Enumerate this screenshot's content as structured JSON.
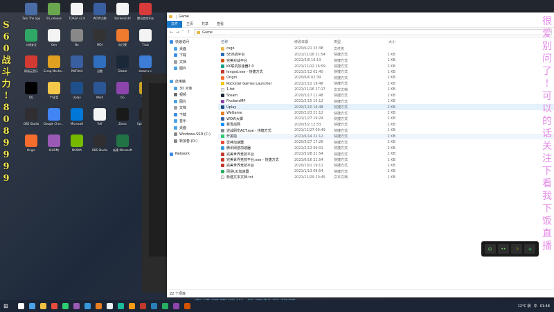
{
  "desktop": {
    "icons": [
      {
        "label": "Task The app",
        "color": "#4a6da7"
      },
      {
        "label": "91_release",
        "color": "#6aa84f"
      },
      {
        "label": "TQAEA v2.9",
        "color": "#f4f4f4"
      },
      {
        "label": "WOW大脚",
        "color": "#3a5fa0"
      },
      {
        "label": "Backend.dll",
        "color": "#f4f4f4"
      },
      {
        "label": "腾讯游戏平台",
        "color": "#d93b3b"
      },
      {
        "label": "火绒安全",
        "color": "#2fa866"
      },
      {
        "label": "Gen",
        "color": "#f4f4f4"
      },
      {
        "label": "Bo",
        "color": "#888888"
      },
      {
        "label": "MOI",
        "color": "#333333"
      },
      {
        "label": "向日葵",
        "color": "#f07b2f"
      },
      {
        "label": "T.bat",
        "color": "#f4f4f4"
      },
      {
        "label": "网易云音乐",
        "color": "#d33a31"
      },
      {
        "label": "Scrap Mechanic",
        "color": "#e0a020"
      },
      {
        "label": "PWFH64",
        "color": "#3a5fa0"
      },
      {
        "label": "迅雷",
        "color": "#2f6fbd"
      },
      {
        "label": "Steam",
        "color": "#1b2838"
      },
      {
        "label": "steam++",
        "color": "#3d7dd8"
      },
      {
        "label": "QQ",
        "color": "#000000"
      },
      {
        "label": "YY语音",
        "color": "#f5c84a"
      },
      {
        "label": "Uplay",
        "color": "#1f4f8a"
      },
      {
        "label": "Word",
        "color": "#2b5797"
      },
      {
        "label": "6G",
        "color": "#8e44ad"
      },
      {
        "label": "WOW",
        "color": "#c9a227"
      },
      {
        "label": "OBS Studio",
        "color": "#302e31"
      },
      {
        "label": "Google Chrome",
        "color": "#4285f4"
      },
      {
        "label": "Microsoft",
        "color": "#0078d7"
      },
      {
        "label": "Toff",
        "color": "#f4f4f4"
      },
      {
        "label": "Zoma",
        "color": "#1a1a1a"
      },
      {
        "label": "Epic Games",
        "color": "#222222"
      },
      {
        "label": "Origin",
        "color": "#f56c2d"
      },
      {
        "label": "4(HDM)",
        "color": "#9b59b6"
      },
      {
        "label": "NVIDIA",
        "color": "#76b900"
      },
      {
        "label": "OBS Studio",
        "color": "#302e31"
      },
      {
        "label": "新建 Microsoft",
        "color": "#217346"
      }
    ],
    "yellow_text": [
      "S",
      "6",
      "0",
      "战",
      "斗",
      "力",
      "!",
      "8",
      "0",
      "8",
      "9",
      "9",
      "9",
      "9"
    ],
    "pink_text": [
      "很",
      "爱",
      "别",
      "问",
      "了",
      "!",
      "可",
      "以",
      "的",
      "话",
      "关",
      "注",
      "下",
      "看",
      "我",
      "下",
      "饭",
      "直",
      "播"
    ]
  },
  "explorer": {
    "title": "Game",
    "ribbon_tabs": [
      "文件",
      "主页",
      "共享",
      "查看"
    ],
    "address": "Game",
    "nav_items": [
      {
        "label": "快速访问",
        "color": "#3c8ce7"
      },
      {
        "label": "桌面",
        "color": "#4aa3e8"
      },
      {
        "label": "下载",
        "color": "#3c8ce7"
      },
      {
        "label": "文档",
        "color": "#9e9e9e"
      },
      {
        "label": "图片",
        "color": "#4aa3e8"
      },
      {
        "label": "",
        "color": "#ffffff"
      },
      {
        "label": "此电脑",
        "color": "#4aa3e8"
      },
      {
        "label": "3D 对象",
        "color": "#4aa3e8"
      },
      {
        "label": "视频",
        "color": "#6d6d6d"
      },
      {
        "label": "图片",
        "color": "#4aa3e8"
      },
      {
        "label": "文档",
        "color": "#9e9e9e"
      },
      {
        "label": "下载",
        "color": "#3c8ce7"
      },
      {
        "label": "音乐",
        "color": "#4aa3e8"
      },
      {
        "label": "桌面",
        "color": "#4aa3e8"
      },
      {
        "label": "Windows-SSD (C:)",
        "color": "#888888"
      },
      {
        "label": "新加卷 (D:)",
        "color": "#888888"
      },
      {
        "label": "",
        "color": "#ffffff"
      },
      {
        "label": "Network",
        "color": "#3c8ce7"
      }
    ],
    "columns": [
      "名称",
      "修改日期",
      "类型",
      "大小"
    ],
    "files": [
      {
        "name": "csgo",
        "date": "2020/6/21 23:38",
        "type": "文件夹",
        "size": "",
        "color": "#e8b84a"
      },
      {
        "name": "5E对战平台",
        "date": "2021/11/18 21:54",
        "type": "快捷方式",
        "size": "2 KB",
        "color": "#2b6cb0"
      },
      {
        "name": "完美对战平台",
        "date": "2021/3/8 16:13",
        "type": "快捷方式",
        "size": "1 KB",
        "color": "#d35400"
      },
      {
        "name": "KK联机加速器2.0",
        "date": "2021/11/12 16:59",
        "type": "快捷方式",
        "size": "2 KB",
        "color": "#16a085"
      },
      {
        "name": "lengod.exe - 快捷方式",
        "date": "2021/2/12 02:40",
        "type": "快捷方式",
        "size": "1 KB",
        "color": "#c0392b"
      },
      {
        "name": "Origin",
        "date": "2020/6/6 02:39",
        "type": "快捷方式",
        "size": "2 KB",
        "color": "#f56c2d"
      },
      {
        "name": "Rockstar Games Launcher",
        "date": "2021/2/12 19:48",
        "type": "快捷方式",
        "size": "2 KB",
        "color": "#f1c40f"
      },
      {
        "name": "1.txt",
        "date": "2021/11/16 17:17",
        "type": "文本文档",
        "size": "1 KB",
        "color": "#ecf0f1"
      },
      {
        "name": "Steam",
        "date": "2020/5/17 11:48",
        "type": "快捷方式",
        "size": "2 KB",
        "color": "#1b2838"
      },
      {
        "name": "FivckersMP",
        "date": "2021/2/15 15:12",
        "type": "快捷方式",
        "size": "1 KB",
        "color": "#8e44ad"
      },
      {
        "name": "Uplay",
        "date": "2020/2/10 16:48",
        "type": "快捷方式",
        "size": "2 KB",
        "color": "#1f4f8a"
      },
      {
        "name": "WeGame",
        "date": "2020/2/23 21:12",
        "type": "快捷方式",
        "size": "2 KB",
        "color": "#e67e22"
      },
      {
        "name": "WOW大脚",
        "date": "2021/1/27 19:24",
        "type": "快捷方式",
        "size": "2 KB",
        "color": "#3a5fa0"
      },
      {
        "name": "暴雪战网",
        "date": "2020/3/2 12:53",
        "type": "快捷方式",
        "size": "2 KB",
        "color": "#148eff"
      },
      {
        "name": "逆战刷伤ACT.exe - 快捷方式",
        "date": "2021/12/27 00:49",
        "type": "快捷方式",
        "size": "1 KB",
        "color": "#7f8c8d"
      },
      {
        "name": "开黑啦",
        "date": "2021/6/14 22:12",
        "type": "快捷方式",
        "size": "2 KB",
        "color": "#2ecc71"
      },
      {
        "name": "雷神加速器",
        "date": "2020/3/27 17:26",
        "type": "快捷方式",
        "size": "2 KB",
        "color": "#e74c3c"
      },
      {
        "name": "腾讯网游加速器",
        "date": "2021/2/12 09:01",
        "type": "快捷方式",
        "size": "2 KB",
        "color": "#3498db"
      },
      {
        "name": "完美世界竞技平台",
        "date": "2021/5/28 21:54",
        "type": "快捷方式",
        "size": "2 KB",
        "color": "#c0392b"
      },
      {
        "name": "完美世界竞技平台.exe - 快捷方式",
        "date": "2021/6/16 21:54",
        "type": "快捷方式",
        "size": "1 KB",
        "color": "#c0392b"
      },
      {
        "name": "完美世界竞技平台",
        "date": "2020/10/1 19:11",
        "type": "快捷方式",
        "size": "2 KB",
        "color": "#c0392b"
      },
      {
        "name": "网易UU加速器",
        "date": "2021/1/13 08:54",
        "type": "快捷方式",
        "size": "2 KB",
        "color": "#27ae60"
      },
      {
        "name": "新建文本文档.txt",
        "date": "2021/11/29 20:45",
        "type": "文本文档",
        "size": "1 KB",
        "color": "#ecf0f1"
      }
    ],
    "status": "22 个项目"
  },
  "floating_toolbar": [
    "中",
    "••",
    "☽",
    "≡"
  ],
  "taskbar": {
    "items": [
      "#ffffff",
      "#4aa3e8",
      "#f0c040",
      "#e74c3c",
      "#2ecc71",
      "#9b59b6",
      "#3498db",
      "#e67e22",
      "#ecf0f1",
      "#1abc9c",
      "#f39c12",
      "#c0392b",
      "#2980b9",
      "#27ae60",
      "#8e44ad",
      "#d35400"
    ],
    "weather": "12°C 阴",
    "ime": "中",
    "time": "01:48"
  },
  "subtitle": "直播间不能说 反正就是想路"
}
